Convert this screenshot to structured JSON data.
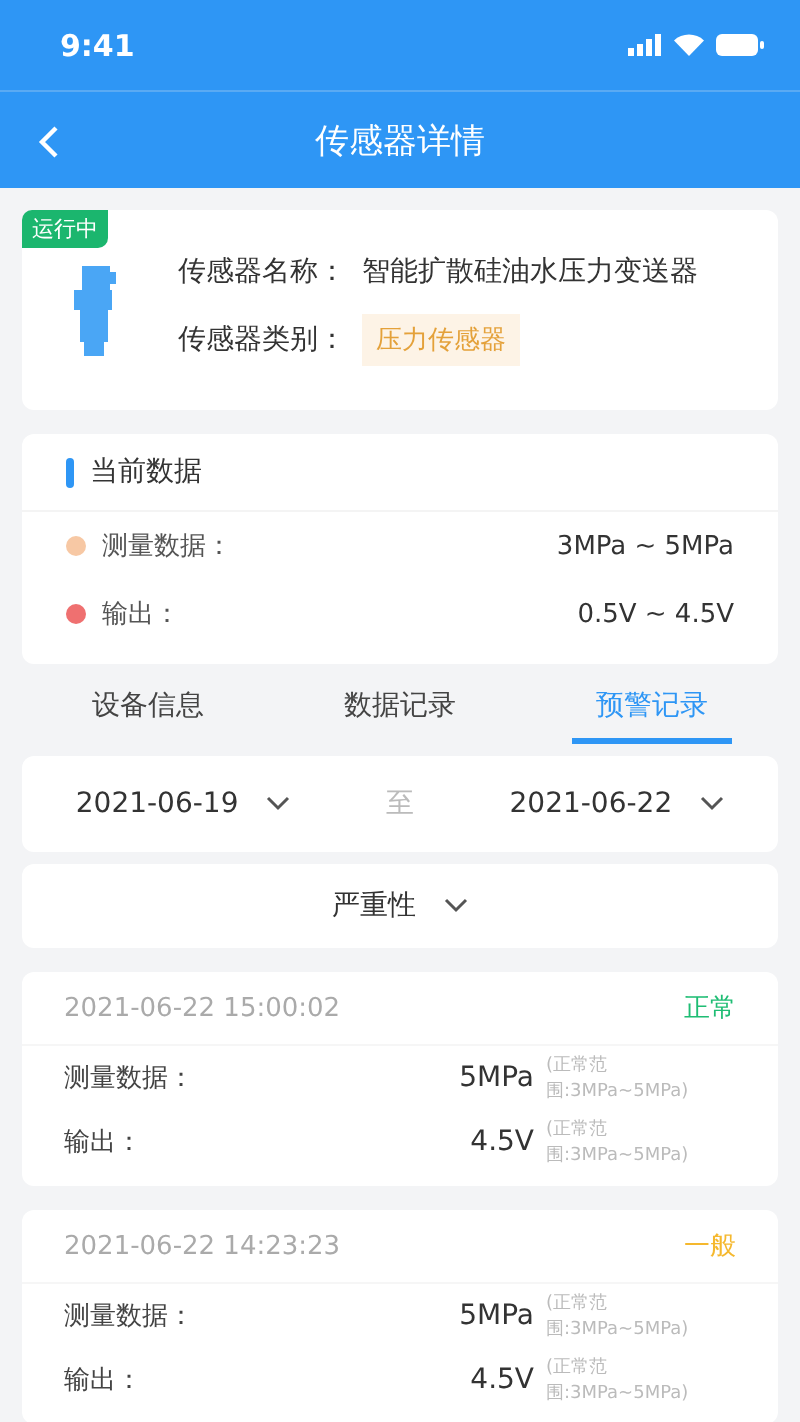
{
  "status_bar": {
    "time": "9:41"
  },
  "nav": {
    "title": "传感器详情"
  },
  "sensor": {
    "status": "运行中",
    "name_label": "传感器名称：",
    "name": "智能扩散硅油水压力变送器",
    "type_label": "传感器类别：",
    "type": "压力传感器"
  },
  "current_data": {
    "title": "当前数据",
    "rows": [
      {
        "label": "测量数据：",
        "value": "3MPa ~ 5MPa",
        "color": "#f7c8a4"
      },
      {
        "label": "输出：",
        "value": "0.5V ~ 4.5V",
        "color": "#ef7070"
      }
    ]
  },
  "tabs": [
    {
      "label": "设备信息",
      "selected": false
    },
    {
      "label": "数据记录",
      "selected": false
    },
    {
      "label": "预警记录",
      "selected": true
    }
  ],
  "date_range": {
    "start": "2021-06-19",
    "separator": "至",
    "end": "2021-06-22"
  },
  "filter": {
    "label": "严重性"
  },
  "records": [
    {
      "time": "2021-06-22 15:00:02",
      "severity": "正常",
      "color": "#1fbd74",
      "rows": [
        {
          "label": "测量数据：",
          "value": "5MPa",
          "range": "(正常范围:3MPa~5MPa)"
        },
        {
          "label": "输出：",
          "value": "4.5V",
          "range": "(正常范围:3MPa~5MPa)"
        }
      ]
    },
    {
      "time": "2021-06-22 14:23:23",
      "severity": "一般",
      "color": "#f5b82e",
      "rows": [
        {
          "label": "测量数据：",
          "value": "5MPa",
          "range": "(正常范围:3MPa~5MPa)"
        },
        {
          "label": "输出：",
          "value": "4.5V",
          "range": "(正常范围:3MPa~5MPa)"
        }
      ]
    }
  ]
}
